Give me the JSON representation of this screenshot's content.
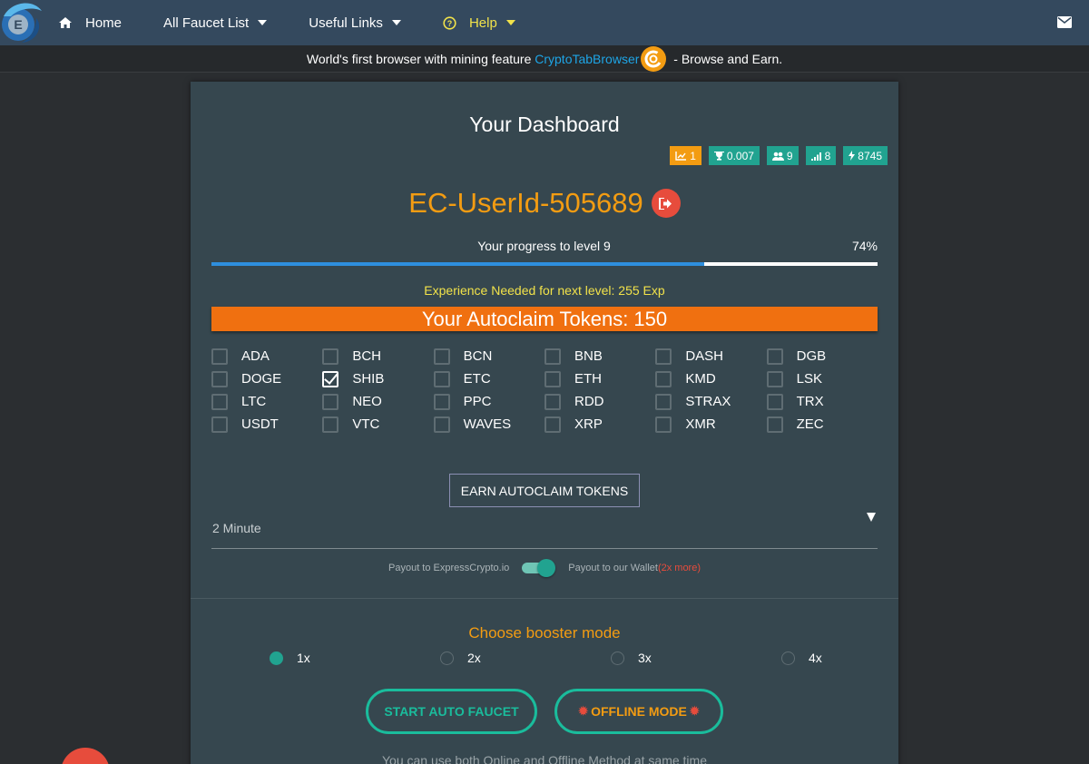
{
  "nav": {
    "home": "Home",
    "faucet_list": "All Faucet List",
    "useful_links": "Useful Links",
    "help": "Help"
  },
  "banner": {
    "text_before": "World's first browser with mining feature ",
    "link": "CryptoTabBrowser",
    "text_after": " - Browse and Earn."
  },
  "dashboard": {
    "title": "Your Dashboard",
    "badges": {
      "level": "1",
      "trophy": "0.007",
      "referrals": "9",
      "signal": "8",
      "energy": "8745"
    },
    "user_id": "EC-UserId-505689",
    "progress_label": "Your progress to level 9",
    "progress_percent_text": "74%",
    "progress_fraction": 0.74,
    "exp_needed": "Experience Needed for next level: 255 Exp",
    "autoclaim_tokens": "Your Autoclaim Tokens: 150"
  },
  "coins": [
    [
      {
        "label": "ADA",
        "checked": false
      },
      {
        "label": "BCH",
        "checked": false
      },
      {
        "label": "BCN",
        "checked": false
      },
      {
        "label": "BNB",
        "checked": false
      },
      {
        "label": "DASH",
        "checked": false
      },
      {
        "label": "DGB",
        "checked": false
      }
    ],
    [
      {
        "label": "DOGE",
        "checked": false
      },
      {
        "label": "SHIB",
        "checked": true
      },
      {
        "label": "ETC",
        "checked": false
      },
      {
        "label": "ETH",
        "checked": false
      },
      {
        "label": "KMD",
        "checked": false
      },
      {
        "label": "LSK",
        "checked": false
      }
    ],
    [
      {
        "label": "LTC",
        "checked": false
      },
      {
        "label": "NEO",
        "checked": false
      },
      {
        "label": "PPC",
        "checked": false
      },
      {
        "label": "RDD",
        "checked": false
      },
      {
        "label": "STRAX",
        "checked": false
      },
      {
        "label": "TRX",
        "checked": false
      }
    ],
    [
      {
        "label": "USDT",
        "checked": false
      },
      {
        "label": "VTC",
        "checked": false
      },
      {
        "label": "WAVES",
        "checked": false
      },
      {
        "label": "XRP",
        "checked": false
      },
      {
        "label": "XMR",
        "checked": false
      },
      {
        "label": "ZEC",
        "checked": false
      }
    ]
  ],
  "earn_button": "EARN AUTOCLAIM TOKENS",
  "interval_select": "2 Minute",
  "payout": {
    "left": "Payout to ExpressCrypto.io",
    "right": "Payout to our Wallet",
    "more": "(2x more)",
    "toggle_on": true
  },
  "booster": {
    "title": "Choose booster mode",
    "options": [
      "1x",
      "2x",
      "3x",
      "4x"
    ],
    "selected": "1x"
  },
  "buttons": {
    "start": "START AUTO FAUCET",
    "offline": "OFFLINE MODE"
  },
  "footnote": "You can use both Online and Offline Method at same time",
  "colors": {
    "navbar": "#34495e",
    "panel": "#36474f",
    "accent_orange": "#f39c12",
    "accent_teal": "#1abc9c",
    "danger": "#e74c3c",
    "tokens_bar": "#f07010",
    "progress": "#2e8fde"
  }
}
